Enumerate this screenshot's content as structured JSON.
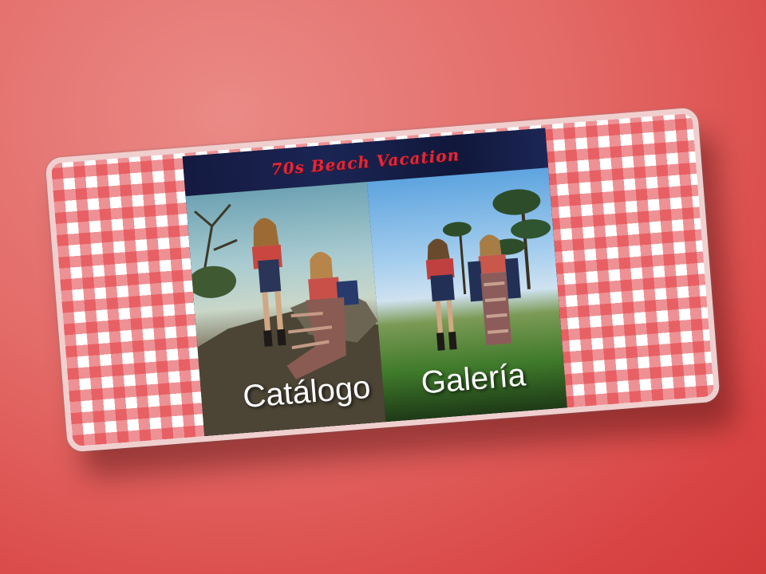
{
  "banner": {
    "title": "70s Beach Vacation",
    "pattern": "red-gingham",
    "colors": {
      "background": "#d84343",
      "gingham_red": "#e1373c",
      "frame_border": "#f0cfcf",
      "title_bar": "#141a40",
      "title_text": "#e1283a"
    }
  },
  "links": [
    {
      "label": "Catálogo"
    },
    {
      "label": "Galería"
    }
  ]
}
